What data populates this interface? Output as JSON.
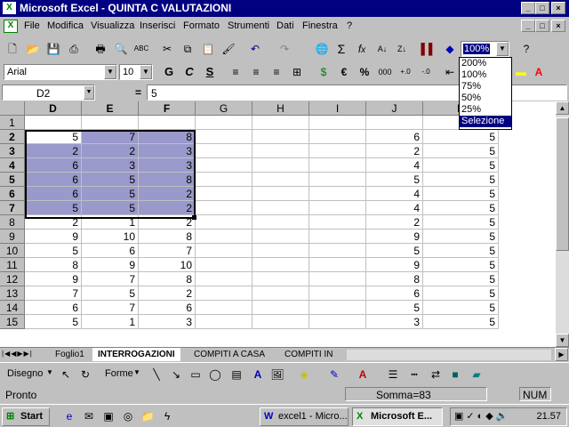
{
  "title": "Microsoft Excel - QUINTA C VALUTAZIONI",
  "menu": [
    "File",
    "Modifica",
    "Visualizza",
    "Inserisci",
    "Formato",
    "Strumenti",
    "Dati",
    "Finestra",
    "?"
  ],
  "font": {
    "name": "Arial",
    "size": "10"
  },
  "zoom": {
    "value": "100%",
    "options": [
      "200%",
      "100%",
      "75%",
      "50%",
      "25%",
      "Selezione"
    ],
    "highlighted": 5
  },
  "formula": {
    "cell": "D2",
    "eq": "=",
    "value": "5"
  },
  "columns": [
    "D",
    "E",
    "F",
    "G",
    "H",
    "I",
    "J",
    "K"
  ],
  "rows": [
    {
      "n": "1",
      "d": "",
      "e": "",
      "f": "",
      "j": "",
      "k": ""
    },
    {
      "n": "2",
      "d": "5",
      "e": "7",
      "f": "8",
      "j": "6",
      "k": "5"
    },
    {
      "n": "3",
      "d": "2",
      "e": "2",
      "f": "3",
      "j": "2",
      "k": "5"
    },
    {
      "n": "4",
      "d": "6",
      "e": "3",
      "f": "3",
      "j": "4",
      "k": "5"
    },
    {
      "n": "5",
      "d": "6",
      "e": "5",
      "f": "8",
      "j": "5",
      "k": "5"
    },
    {
      "n": "6",
      "d": "6",
      "e": "5",
      "f": "2",
      "j": "4",
      "k": "5"
    },
    {
      "n": "7",
      "d": "5",
      "e": "5",
      "f": "2",
      "j": "4",
      "k": "5"
    },
    {
      "n": "8",
      "d": "2",
      "e": "1",
      "f": "2",
      "j": "2",
      "k": "5"
    },
    {
      "n": "9",
      "d": "9",
      "e": "10",
      "f": "8",
      "j": "9",
      "k": "5"
    },
    {
      "n": "10",
      "d": "5",
      "e": "6",
      "f": "7",
      "j": "5",
      "k": "5"
    },
    {
      "n": "11",
      "d": "8",
      "e": "9",
      "f": "10",
      "j": "9",
      "k": "5"
    },
    {
      "n": "12",
      "d": "9",
      "e": "7",
      "f": "8",
      "j": "8",
      "k": "5"
    },
    {
      "n": "13",
      "d": "7",
      "e": "5",
      "f": "2",
      "j": "6",
      "k": "5"
    },
    {
      "n": "14",
      "d": "6",
      "e": "7",
      "f": "6",
      "j": "5",
      "k": "5"
    },
    {
      "n": "15",
      "d": "5",
      "e": "1",
      "f": "3",
      "j": "3",
      "k": "5"
    }
  ],
  "sheets": [
    "Foglio1",
    "INTERROGAZIONI",
    "COMPITI A CASA",
    "COMPITI IN"
  ],
  "drawing": {
    "disegno": "Disegno",
    "forme": "Forme"
  },
  "status": {
    "left": "Pronto",
    "sum": "Somma=83",
    "num": "NUM"
  },
  "taskbar": {
    "start": "Start",
    "tasks": [
      "excel1 - Micro...",
      "Microsoft E..."
    ],
    "clock": "21.57"
  }
}
